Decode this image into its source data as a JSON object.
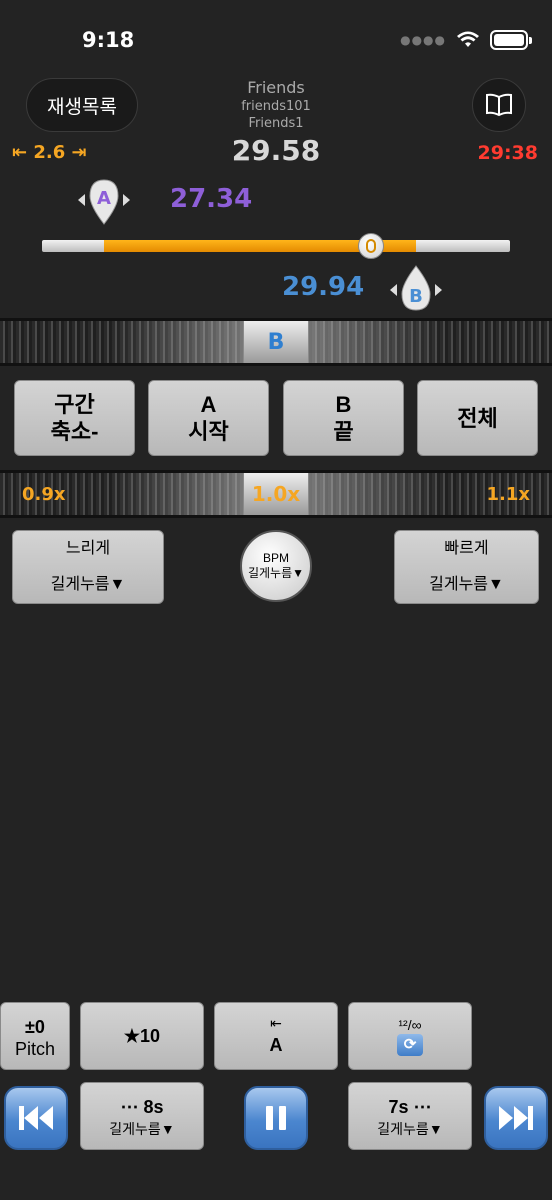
{
  "status": {
    "time": "9:18"
  },
  "header": {
    "playlist_label": "재생목록",
    "track_title": "Friends",
    "track_sub1": "friends101",
    "track_sub2": "Friends1",
    "current_time": "29.58",
    "shift_value": "⇤ 2.6 ⇥",
    "total_time": "29:38"
  },
  "ab": {
    "a_label": "A",
    "a_time": "27.34",
    "b_label": "B",
    "b_time": "29.94"
  },
  "section_wheel": {
    "label": "B"
  },
  "section_buttons": [
    {
      "line1": "구간",
      "line2": "축소-"
    },
    {
      "line1": "A",
      "line2": "시작"
    },
    {
      "line1": "B",
      "line2": "끝"
    },
    {
      "line1": "전체",
      "line2": ""
    }
  ],
  "speed_wheel": {
    "left": "0.9x",
    "center": "1.0x",
    "right": "1.1x"
  },
  "speed_controls": {
    "slow_label": "느리게",
    "slow_sub": "길게누름▼",
    "bpm_label": "BPM",
    "bpm_sub": "길게누름▼",
    "fast_label": "빠르게",
    "fast_sub": "길게누름▼"
  },
  "bottom": {
    "pitch_value": "±0",
    "pitch_label": "Pitch",
    "star_label": "★10",
    "goto_a_arrow": "⇤",
    "goto_a_label": "A",
    "loop_label": "¹²/∞",
    "back_label": "⋯ 8s",
    "back_sub": "길게누름▼",
    "fwd_label": "7s ⋯",
    "fwd_sub": "길게누름▼"
  },
  "colors": {
    "accent_orange": "#f5a623",
    "a_purple": "#8e5fd8",
    "b_blue": "#4a8fd4",
    "total_red": "#ff3b30"
  },
  "progress": {
    "range_start_fraction": 0.13,
    "range_end_fraction": 0.8,
    "position_fraction": 0.7
  }
}
